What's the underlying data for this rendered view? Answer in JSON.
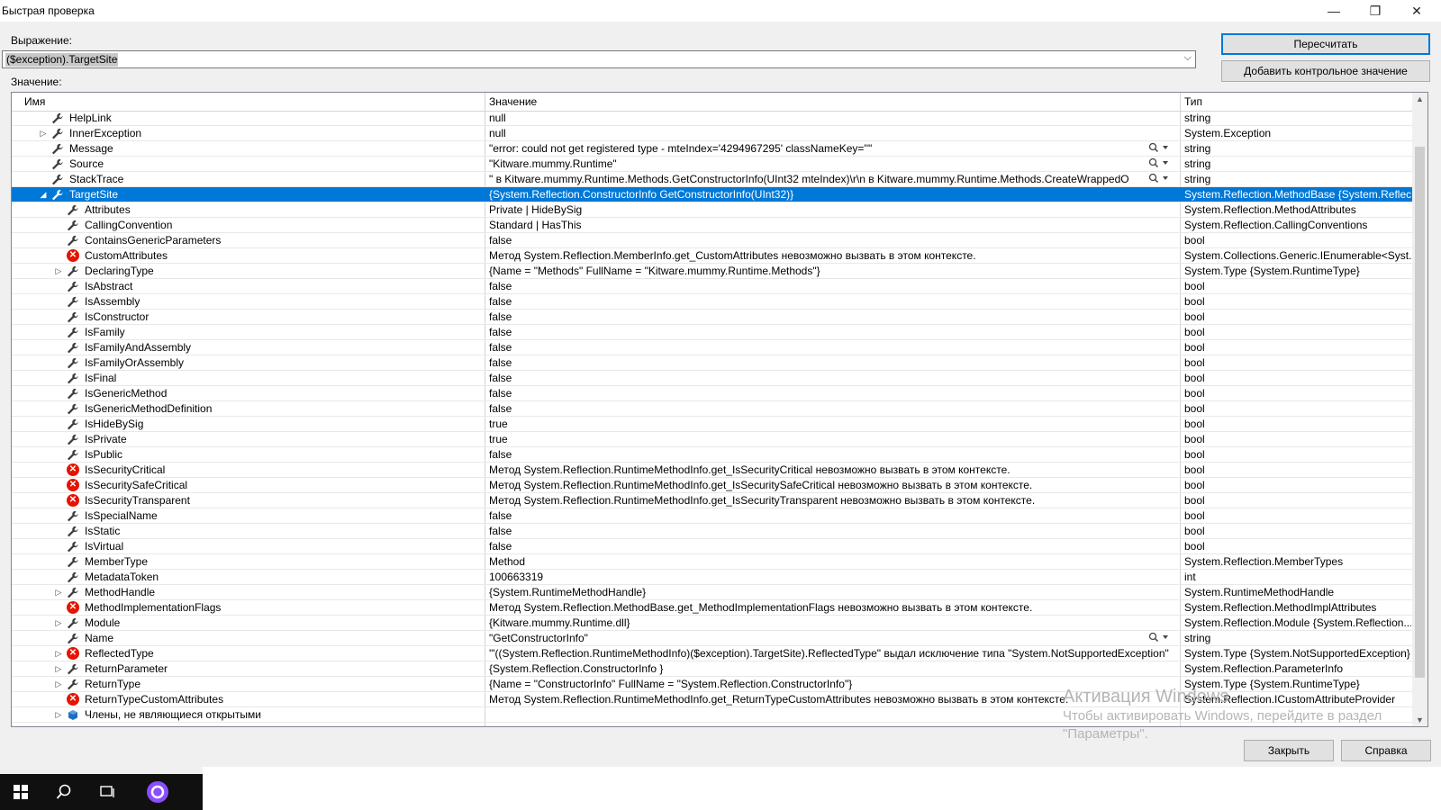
{
  "window": {
    "title": "Быстрая проверка",
    "minimize": "—",
    "restore": "❐",
    "close": "✕"
  },
  "expression": {
    "label": "Выражение:",
    "value": "($exception).TargetSite",
    "dropdown": "⌵"
  },
  "value_label": "Значение:",
  "buttons": {
    "recalc": "Пересчитать",
    "add_watch": "Добавить контрольное значение",
    "close": "Закрыть",
    "help": "Справка"
  },
  "columns": {
    "name": "Имя",
    "value": "Значение",
    "type": "Тип"
  },
  "rows": [
    {
      "level": 2,
      "exp": "",
      "icon": "wrench",
      "name": "HelpLink",
      "value": "null",
      "type": "string"
    },
    {
      "level": 2,
      "exp": "▷",
      "icon": "wrench",
      "name": "InnerException",
      "value": "null",
      "type": "System.Exception"
    },
    {
      "level": 2,
      "exp": "",
      "icon": "wrench",
      "name": "Message",
      "value": "\"error: could not get registered type - mteIndex='4294967295' classNameKey=''\"",
      "type": "string",
      "mag": true
    },
    {
      "level": 2,
      "exp": "",
      "icon": "wrench",
      "name": "Source",
      "value": "\"Kitware.mummy.Runtime\"",
      "type": "string",
      "mag": true
    },
    {
      "level": 2,
      "exp": "",
      "icon": "wrench",
      "name": "StackTrace",
      "value": "\"   в Kitware.mummy.Runtime.Methods.GetConstructorInfo(UInt32 mteIndex)\\r\\n   в Kitware.mummy.Runtime.Methods.CreateWrappedO...",
      "type": "string",
      "mag": true
    },
    {
      "level": 2,
      "exp": "◢",
      "icon": "wrench",
      "name": "TargetSite",
      "value": "{System.Reflection.ConstructorInfo GetConstructorInfo(UInt32)}",
      "type": "System.Reflection.MethodBase {System.Reflec...",
      "sel": true
    },
    {
      "level": 3,
      "exp": "",
      "icon": "wrench",
      "name": "Attributes",
      "value": "Private | HideBySig",
      "type": "System.Reflection.MethodAttributes"
    },
    {
      "level": 3,
      "exp": "",
      "icon": "wrench",
      "name": "CallingConvention",
      "value": "Standard | HasThis",
      "type": "System.Reflection.CallingConventions"
    },
    {
      "level": 3,
      "exp": "",
      "icon": "wrench",
      "name": "ContainsGenericParameters",
      "value": "false",
      "type": "bool"
    },
    {
      "level": 3,
      "exp": "",
      "icon": "error",
      "name": "CustomAttributes",
      "value": "Метод System.Reflection.MemberInfo.get_CustomAttributes невозможно вызвать в этом контексте.",
      "type": "System.Collections.Generic.IEnumerable<Syst..."
    },
    {
      "level": 3,
      "exp": "▷",
      "icon": "wrench",
      "name": "DeclaringType",
      "value": "{Name = \"Methods\" FullName = \"Kitware.mummy.Runtime.Methods\"}",
      "type": "System.Type {System.RuntimeType}"
    },
    {
      "level": 3,
      "exp": "",
      "icon": "wrench",
      "name": "IsAbstract",
      "value": "false",
      "type": "bool"
    },
    {
      "level": 3,
      "exp": "",
      "icon": "wrench",
      "name": "IsAssembly",
      "value": "false",
      "type": "bool"
    },
    {
      "level": 3,
      "exp": "",
      "icon": "wrench",
      "name": "IsConstructor",
      "value": "false",
      "type": "bool"
    },
    {
      "level": 3,
      "exp": "",
      "icon": "wrench",
      "name": "IsFamily",
      "value": "false",
      "type": "bool"
    },
    {
      "level": 3,
      "exp": "",
      "icon": "wrench",
      "name": "IsFamilyAndAssembly",
      "value": "false",
      "type": "bool"
    },
    {
      "level": 3,
      "exp": "",
      "icon": "wrench",
      "name": "IsFamilyOrAssembly",
      "value": "false",
      "type": "bool"
    },
    {
      "level": 3,
      "exp": "",
      "icon": "wrench",
      "name": "IsFinal",
      "value": "false",
      "type": "bool"
    },
    {
      "level": 3,
      "exp": "",
      "icon": "wrench",
      "name": "IsGenericMethod",
      "value": "false",
      "type": "bool"
    },
    {
      "level": 3,
      "exp": "",
      "icon": "wrench",
      "name": "IsGenericMethodDefinition",
      "value": "false",
      "type": "bool"
    },
    {
      "level": 3,
      "exp": "",
      "icon": "wrench",
      "name": "IsHideBySig",
      "value": "true",
      "type": "bool"
    },
    {
      "level": 3,
      "exp": "",
      "icon": "wrench",
      "name": "IsPrivate",
      "value": "true",
      "type": "bool"
    },
    {
      "level": 3,
      "exp": "",
      "icon": "wrench",
      "name": "IsPublic",
      "value": "false",
      "type": "bool"
    },
    {
      "level": 3,
      "exp": "",
      "icon": "error",
      "name": "IsSecurityCritical",
      "value": "Метод System.Reflection.RuntimeMethodInfo.get_IsSecurityCritical невозможно вызвать в этом контексте.",
      "type": "bool"
    },
    {
      "level": 3,
      "exp": "",
      "icon": "error",
      "name": "IsSecuritySafeCritical",
      "value": "Метод System.Reflection.RuntimeMethodInfo.get_IsSecuritySafeCritical невозможно вызвать в этом контексте.",
      "type": "bool"
    },
    {
      "level": 3,
      "exp": "",
      "icon": "error",
      "name": "IsSecurityTransparent",
      "value": "Метод System.Reflection.RuntimeMethodInfo.get_IsSecurityTransparent невозможно вызвать в этом контексте.",
      "type": "bool"
    },
    {
      "level": 3,
      "exp": "",
      "icon": "wrench",
      "name": "IsSpecialName",
      "value": "false",
      "type": "bool"
    },
    {
      "level": 3,
      "exp": "",
      "icon": "wrench",
      "name": "IsStatic",
      "value": "false",
      "type": "bool"
    },
    {
      "level": 3,
      "exp": "",
      "icon": "wrench",
      "name": "IsVirtual",
      "value": "false",
      "type": "bool"
    },
    {
      "level": 3,
      "exp": "",
      "icon": "wrench",
      "name": "MemberType",
      "value": "Method",
      "type": "System.Reflection.MemberTypes"
    },
    {
      "level": 3,
      "exp": "",
      "icon": "wrench",
      "name": "MetadataToken",
      "value": "100663319",
      "type": "int"
    },
    {
      "level": 3,
      "exp": "▷",
      "icon": "wrench",
      "name": "MethodHandle",
      "value": "{System.RuntimeMethodHandle}",
      "type": "System.RuntimeMethodHandle"
    },
    {
      "level": 3,
      "exp": "",
      "icon": "error",
      "name": "MethodImplementationFlags",
      "value": "Метод System.Reflection.MethodBase.get_MethodImplementationFlags невозможно вызвать в этом контексте.",
      "type": "System.Reflection.MethodImplAttributes"
    },
    {
      "level": 3,
      "exp": "▷",
      "icon": "wrench",
      "name": "Module",
      "value": "{Kitware.mummy.Runtime.dll}",
      "type": "System.Reflection.Module {System.Reflection...."
    },
    {
      "level": 3,
      "exp": "",
      "icon": "wrench",
      "name": "Name",
      "value": "\"GetConstructorInfo\"",
      "type": "string",
      "mag": true
    },
    {
      "level": 3,
      "exp": "▷",
      "icon": "error",
      "name": "ReflectedType",
      "value": "'\"((System.Reflection.RuntimeMethodInfo)($exception).TargetSite).ReflectedType\" выдал исключение типа \"System.NotSupportedException\"",
      "type": "System.Type {System.NotSupportedException}"
    },
    {
      "level": 3,
      "exp": "▷",
      "icon": "wrench",
      "name": "ReturnParameter",
      "value": "{System.Reflection.ConstructorInfo }",
      "type": "System.Reflection.ParameterInfo"
    },
    {
      "level": 3,
      "exp": "▷",
      "icon": "wrench",
      "name": "ReturnType",
      "value": "{Name = \"ConstructorInfo\" FullName = \"System.Reflection.ConstructorInfo\"}",
      "type": "System.Type {System.RuntimeType}"
    },
    {
      "level": 3,
      "exp": "",
      "icon": "error",
      "name": "ReturnTypeCustomAttributes",
      "value": "Метод System.Reflection.RuntimeMethodInfo.get_ReturnTypeCustomAttributes невозможно вызвать в этом контексте.",
      "type": "System.Reflection.ICustomAttributeProvider"
    },
    {
      "level": 3,
      "exp": "▷",
      "icon": "members",
      "name": "Члены, не являющиеся открытыми",
      "value": "",
      "type": ""
    }
  ],
  "watermark": {
    "line1": "Активация Windows",
    "line2": "Чтобы активировать Windows, перейдите в раздел",
    "line3": "\"Параметры\"."
  },
  "colors": {
    "selection": "#0078d7",
    "error": "#e51400",
    "button_focus": "#0078d7"
  }
}
